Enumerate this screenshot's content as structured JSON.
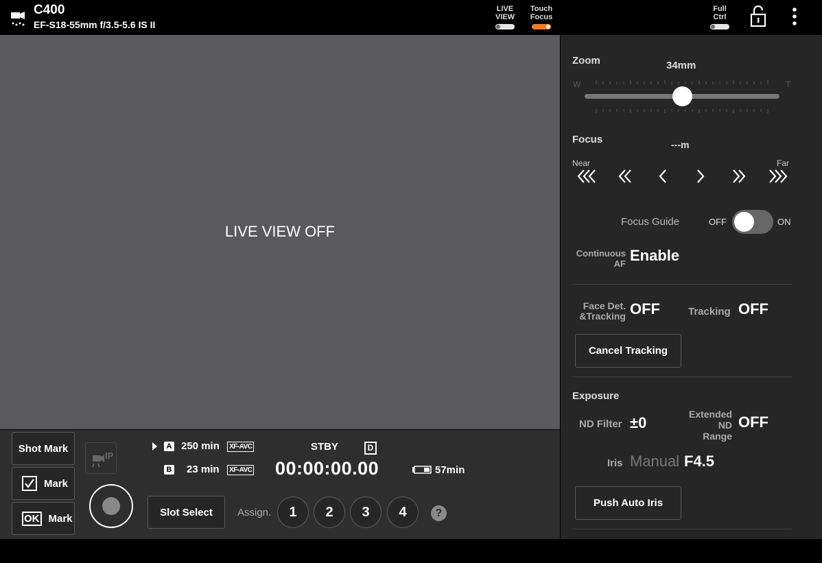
{
  "header": {
    "camera_model": "C400",
    "lens": "EF-S18-55mm f/3.5-5.6 IS II",
    "live_view_label_1": "LIVE",
    "live_view_label_2": "VIEW",
    "touch_focus_label_1": "Touch",
    "touch_focus_label_2": "Focus",
    "full_ctrl_label_1": "Full",
    "full_ctrl_label_2": "Ctrl",
    "live_view_on": false,
    "touch_focus_on": true,
    "full_ctrl_on": false,
    "accent_color": "#f47a20"
  },
  "liveview": {
    "status_text": "LIVE VIEW OFF"
  },
  "bottom": {
    "shot_mark_label": "Shot Mark",
    "check_mark_label": "Mark",
    "ok_mark_label": "Mark",
    "ok_glyph": "OK",
    "slot_a_letter": "A",
    "slot_a_time": "250 min",
    "slot_b_letter": "B",
    "slot_b_time": "23 min",
    "codec_a": "XF-AVC",
    "codec_b": "XF-AVC",
    "status": "STBY",
    "timecode": "00:00:00.00",
    "d_badge": "D",
    "battery_time": "57min",
    "slot_select_label": "Slot Select",
    "assign_label": "Assign.",
    "assign_buttons": [
      "1",
      "2",
      "3",
      "4"
    ],
    "help_glyph": "?"
  },
  "zoom": {
    "label": "Zoom",
    "value": "34mm",
    "wide_label": "W",
    "tele_label": "T",
    "position_fraction": 0.5
  },
  "focus": {
    "label": "Focus",
    "value": "---m",
    "near_label": "Near",
    "far_label": "Far",
    "guide_label": "Focus Guide",
    "guide_off": "OFF",
    "guide_on": "ON",
    "guide_enabled": false,
    "continuous_af_label_1": "Continuous",
    "continuous_af_label_2": "AF",
    "continuous_af_value": "Enable"
  },
  "tracking": {
    "face_det_label_1": "Face Det.",
    "face_det_label_2": "&Tracking",
    "face_det_value": "OFF",
    "tracking_label": "Tracking",
    "tracking_value": "OFF",
    "cancel_label": "Cancel Tracking"
  },
  "exposure": {
    "label": "Exposure",
    "nd_label": "ND Filter",
    "nd_value": "±0",
    "ext_nd_label_1": "Extended",
    "ext_nd_label_2": "ND",
    "ext_nd_label_3": "Range",
    "ext_nd_value": "OFF",
    "iris_label": "Iris",
    "iris_mode": "Manual",
    "iris_value": "F4.5",
    "push_auto_iris_label": "Push Auto Iris"
  }
}
